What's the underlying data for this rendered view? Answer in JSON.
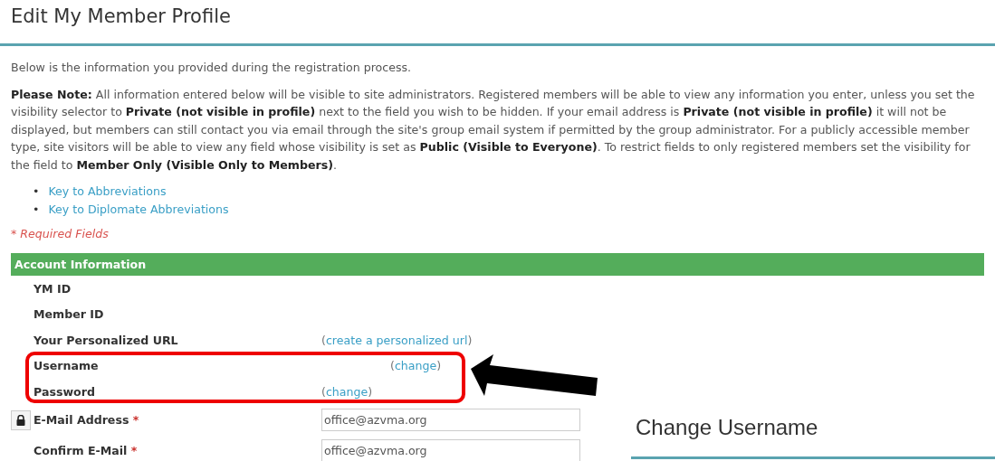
{
  "page_title": "Edit My Member Profile",
  "intro": "Below is the information you provided during the registration process.",
  "note": "**Please Note:** All information entered below will be visible to site administrators. Registered members will be able to view any information you enter, unless you set the visibility selector to **Private (not visible in profile)** next to the field you wish to be hidden. If your email address is **Private (not visible in profile)** it will not be displayed, but members can still contact you via email through the site's group email system if permitted by the group administrator. For a publicly accessible member type, site visitors will be able to view any field whose visibility is set as **Public (Visible to Everyone)**. To restrict fields to only registered members set the visibility for the field to **Member Only (Visible Only to Members)**.",
  "links": [
    {
      "bullet": "•",
      "text": "Key to Abbreviations"
    },
    {
      "bullet": "•",
      "text": "Key to Diplomate Abbreviations"
    }
  ],
  "required_note": "* Required Fields",
  "section": {
    "title": "Account Information",
    "fields": [
      {
        "kind": "plain",
        "label": "YM ID"
      },
      {
        "kind": "plain",
        "label": "Member ID"
      },
      {
        "kind": "link",
        "label": "Your Personalized URL",
        "before": "(",
        "link": "create a personalized url",
        "after": ")"
      },
      {
        "kind": "link-offset",
        "label": "Username",
        "before": "(",
        "link": "change",
        "after": ")"
      },
      {
        "kind": "link",
        "label": "Password",
        "before": "(",
        "link": "change",
        "after": ")"
      },
      {
        "kind": "input",
        "label": "E-Mail Address",
        "required_mark": "*",
        "value": "office@azvma.org",
        "locked": true
      },
      {
        "kind": "input",
        "label": "Confirm E-Mail",
        "required_mark": "*",
        "value": "office@azvma.org",
        "locked": false
      }
    ]
  },
  "overlay_panel": {
    "title": "Change Username"
  }
}
